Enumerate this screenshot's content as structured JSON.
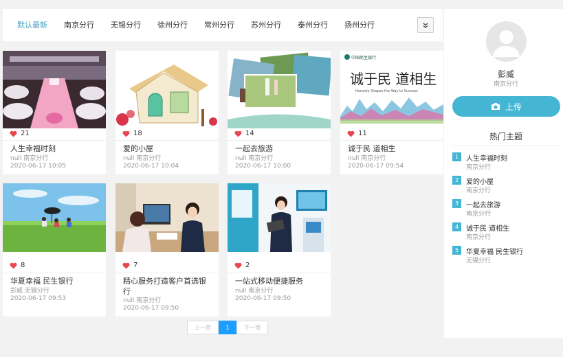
{
  "tabs": [
    {
      "label": "默认最新",
      "active": true
    },
    {
      "label": "南京分行",
      "active": false
    },
    {
      "label": "无锡分行",
      "active": false
    },
    {
      "label": "徐州分行",
      "active": false
    },
    {
      "label": "常州分行",
      "active": false
    },
    {
      "label": "苏州分行",
      "active": false
    },
    {
      "label": "泰州分行",
      "active": false
    },
    {
      "label": "扬州分行",
      "active": false
    }
  ],
  "more_icon": "double-chevron-down-icon",
  "posts": [
    {
      "likes": "21",
      "title": "人生幸福时刻",
      "author_branch": "null 南京分行",
      "date": "2020-06-17 10:05"
    },
    {
      "likes": "18",
      "title": "爱的小屋",
      "author_branch": "null 南京分行",
      "date": "2020-06-17 10:04"
    },
    {
      "likes": "14",
      "title": "一起去旅游",
      "author_branch": "null 南京分行",
      "date": "2020-06-17 10:00"
    },
    {
      "likes": "11",
      "title": "诚于民 道相生",
      "author_branch": "null 南京分行",
      "date": "2020-06-17 09:54"
    },
    {
      "likes": "8",
      "title": "华夏幸福 民生银行",
      "author_branch": "彭威 无锡分行",
      "date": "2020-06-17 09:53"
    },
    {
      "likes": "7",
      "title": "精心服务打造客户首选银行",
      "author_branch": "null 南京分行",
      "date": "2020-06-17 09:50"
    },
    {
      "likes": "2",
      "title": "一站式移动便捷服务",
      "author_branch": "null 南京分行",
      "date": "2020-06-17 09:50"
    }
  ],
  "image_texts": {
    "bank_logo": "中国民生银行",
    "slogan_main": "诚于民 道相生",
    "slogan_sub": "Honesty Shapes the Way to Success"
  },
  "pagination": {
    "prev": "上一页",
    "current": "1",
    "next": "下一页"
  },
  "user": {
    "name": "彭威",
    "branch": "南京分行"
  },
  "upload_label": "上传",
  "hot": {
    "title": "热门主题",
    "items": [
      {
        "num": "1",
        "name": "人生幸福时刻",
        "branch": "南京分行"
      },
      {
        "num": "2",
        "name": "爱的小屋",
        "branch": "南京分行"
      },
      {
        "num": "3",
        "name": "一起去旅游",
        "branch": "南京分行"
      },
      {
        "num": "4",
        "name": "诚于民 道相生",
        "branch": "南京分行"
      },
      {
        "num": "5",
        "name": "华夏幸福 民生银行",
        "branch": "无锡分行"
      }
    ]
  },
  "colors": {
    "accent": "#45b5d4",
    "active_tab": "#4aa6c7",
    "pager_current": "#1e9fff",
    "heart": "#e8464f"
  }
}
